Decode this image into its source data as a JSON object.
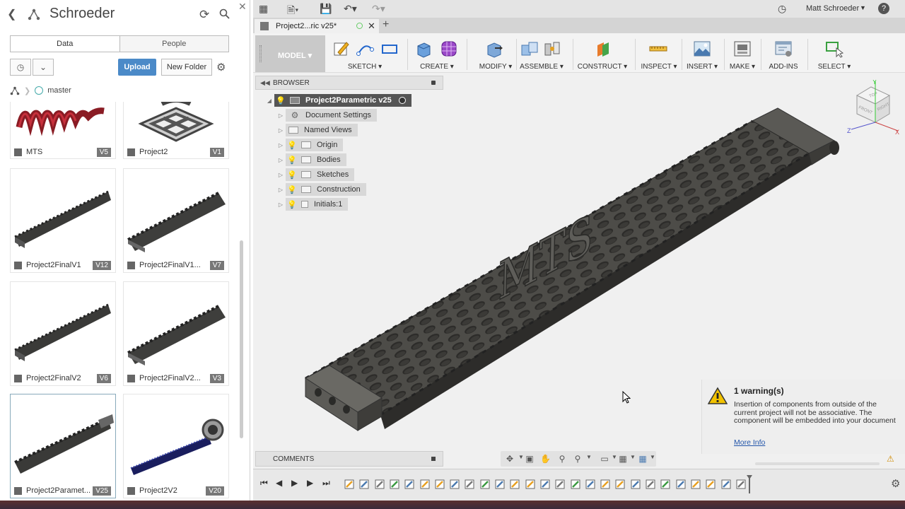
{
  "data_panel": {
    "title": "Schroeder",
    "tabs": [
      "Data",
      "People"
    ],
    "upload_label": "Upload",
    "new_folder_label": "New Folder",
    "breadcrumb_branch": "master",
    "files": [
      {
        "name": "MTS",
        "version": "V5"
      },
      {
        "name": "Project2",
        "version": "V1"
      },
      {
        "name": "Project2FinalV1",
        "version": "V12"
      },
      {
        "name": "Project2FinalV1...",
        "version": "V7"
      },
      {
        "name": "Project2FinalV2",
        "version": "V6"
      },
      {
        "name": "Project2FinalV2...",
        "version": "V3"
      },
      {
        "name": "Project2Paramet...",
        "version": "V25"
      },
      {
        "name": "Project2V2",
        "version": "V20"
      }
    ]
  },
  "topbar": {
    "user_name": "Matt Schroeder",
    "help_label": "?"
  },
  "document_tab": {
    "title": "Project2...ric v25*"
  },
  "ribbon": {
    "workspace": "MODEL",
    "groups": [
      "SKETCH",
      "CREATE",
      "MODIFY",
      "ASSEMBLE",
      "CONSTRUCT",
      "INSPECT",
      "INSERT",
      "MAKE",
      "ADD-INS",
      "SELECT"
    ]
  },
  "browser": {
    "header": "BROWSER",
    "root": "Project2Parametric v25",
    "items": [
      "Document Settings",
      "Named Views",
      "Origin",
      "Bodies",
      "Sketches",
      "Construction",
      "Initials:1"
    ]
  },
  "viewcube": {
    "faces": [
      "TOP",
      "FRONT",
      "RIGHT"
    ],
    "axes": [
      "Y",
      "Z",
      "X"
    ]
  },
  "model": {
    "engraved_text": "MTS"
  },
  "comments": {
    "header": "COMMENTS"
  },
  "warning": {
    "title": "1 warning(s)",
    "message": "Insertion of components from outside of the current project will not be associative. The component will be embedded into your document",
    "link": "More Info"
  },
  "colors": {
    "accent": "#4b8ac8",
    "model_body": "#4a4a46",
    "warning_icon": "#f2c200"
  }
}
